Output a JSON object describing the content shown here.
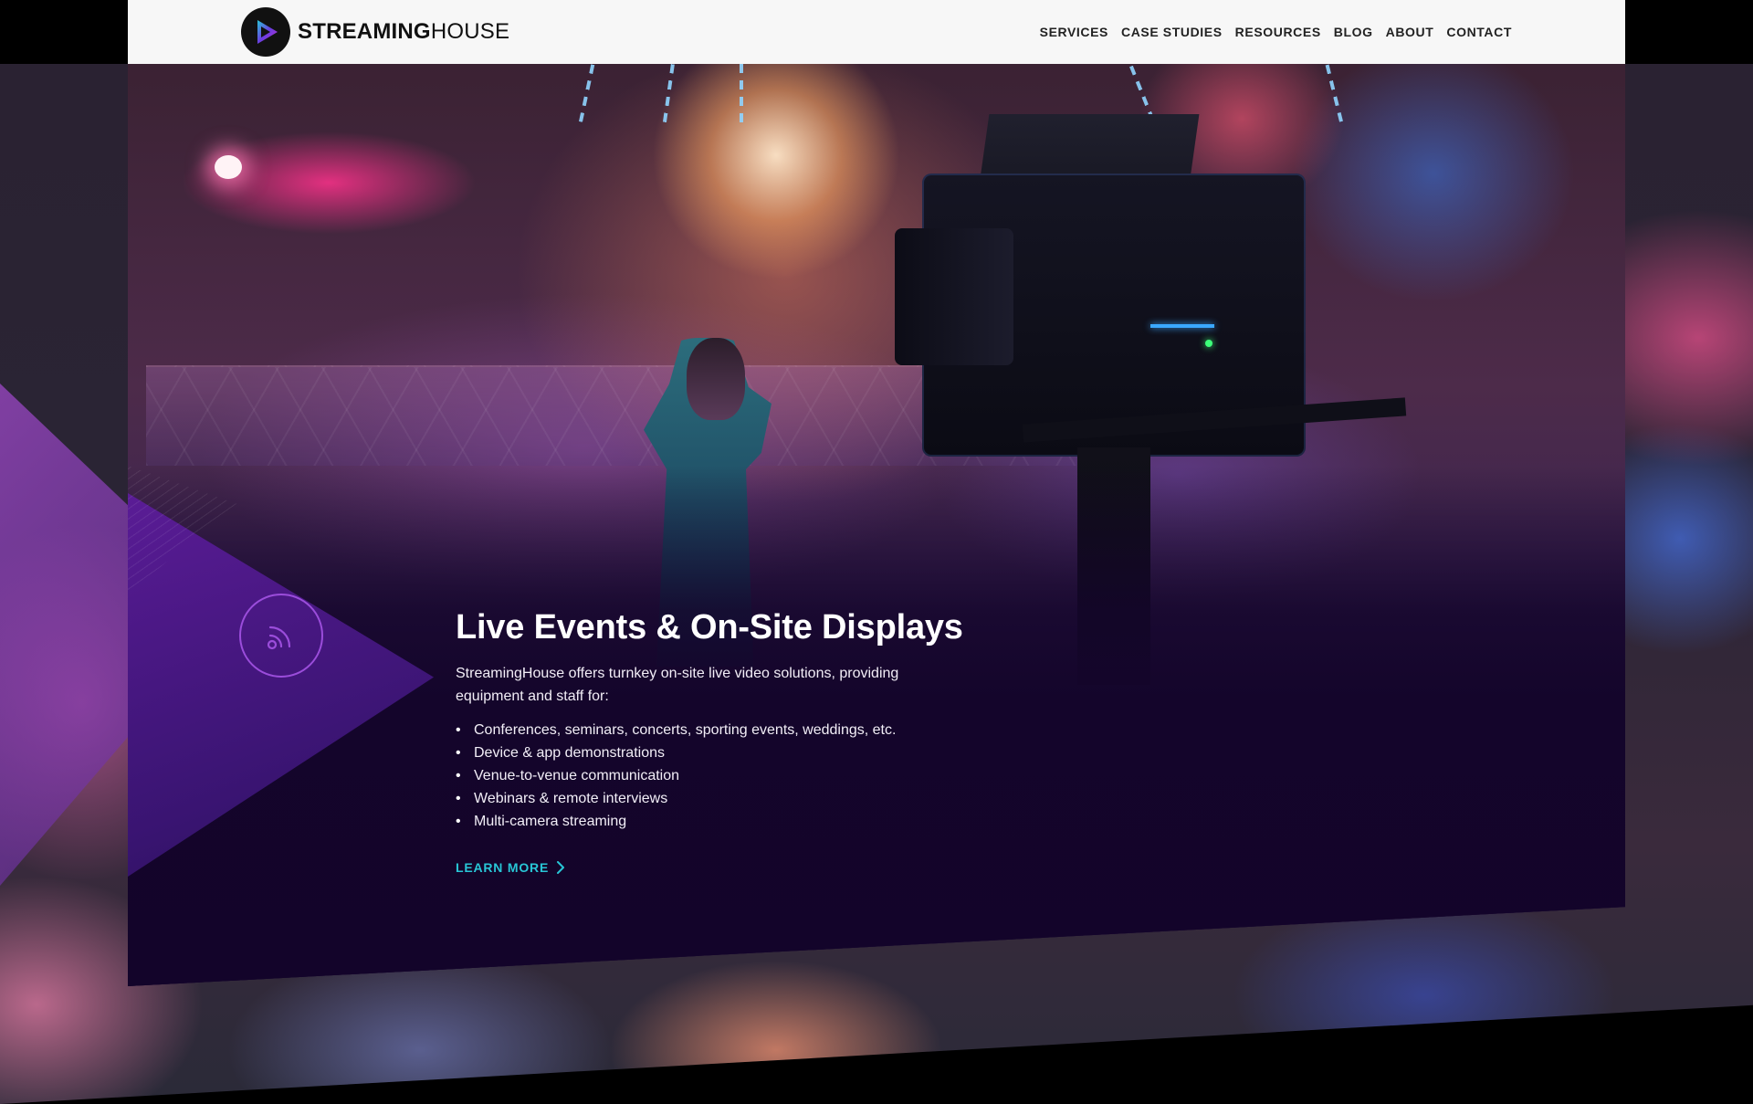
{
  "header": {
    "logo_bold": "STREAMING",
    "logo_light": "HOUSE",
    "nav": [
      "SERVICES",
      "CASE STUDIES",
      "RESOURCES",
      "BLOG",
      "ABOUT",
      "CONTACT"
    ]
  },
  "feature": {
    "icon": "rss-icon",
    "title": "Live Events & On-Site Displays",
    "description": "StreamingHouse offers turnkey on-site live video solutions, providing equipment and staff for:",
    "bullets": [
      "Conferences, seminars, concerts, sporting events, weddings, etc.",
      "Device & app demonstrations",
      "Venue-to-venue communication",
      "Webinars & remote interviews",
      "Multi-camera streaming"
    ],
    "cta": "LEARN MORE"
  },
  "colors": {
    "accent_cyan": "#28c6d6",
    "accent_purple": "#9b4ddb",
    "card_dark": "#14052b",
    "header_bg": "#f7f7f7"
  }
}
